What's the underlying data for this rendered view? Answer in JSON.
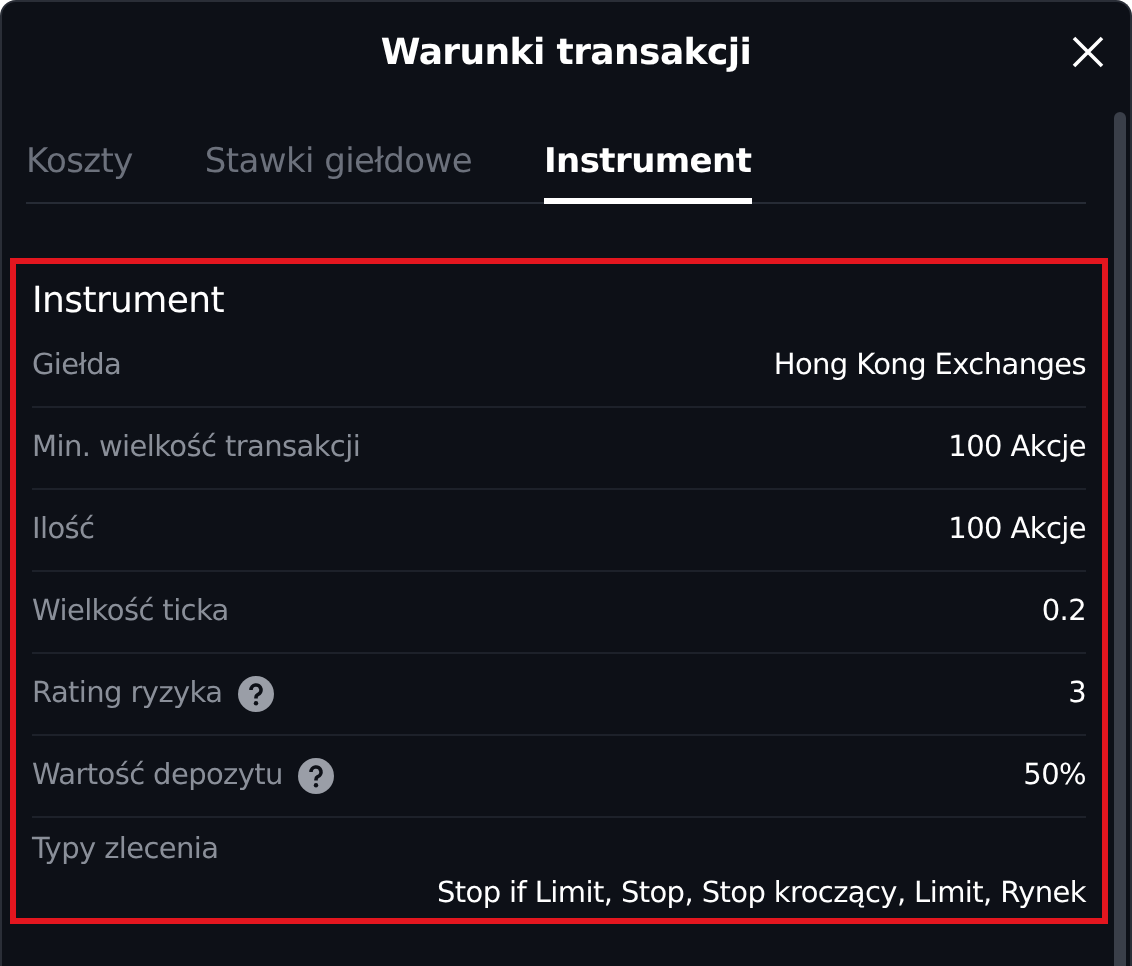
{
  "window": {
    "title": "Warunki transakcji"
  },
  "tabs": [
    {
      "label": "Koszty",
      "selected": false
    },
    {
      "label": "Stawki giełdowe",
      "selected": false
    },
    {
      "label": "Instrument",
      "selected": true
    }
  ],
  "section": {
    "title": "Instrument",
    "highlighted": true,
    "rows": [
      {
        "label": "Giełda",
        "value": "Hong Kong Exchanges",
        "info_icon": false,
        "kind": "inline"
      },
      {
        "label": "Min. wielkość transakcji",
        "value": "100 Akcje",
        "info_icon": false,
        "kind": "inline"
      },
      {
        "label": "Ilość",
        "value": "100 Akcje",
        "info_icon": false,
        "kind": "inline"
      },
      {
        "label": "Wielkość ticka",
        "value": "0.2",
        "info_icon": false,
        "kind": "inline"
      },
      {
        "label": "Rating ryzyka",
        "value": "3",
        "info_icon": true,
        "kind": "inline"
      },
      {
        "label": "Wartość depozytu",
        "value": "50%",
        "info_icon": true,
        "kind": "inline"
      },
      {
        "label": "Typy zlecenia",
        "value": "Stop if Limit, Stop, Stop kroczący, Limit, Rynek",
        "info_icon": false,
        "kind": "stacked"
      }
    ]
  }
}
